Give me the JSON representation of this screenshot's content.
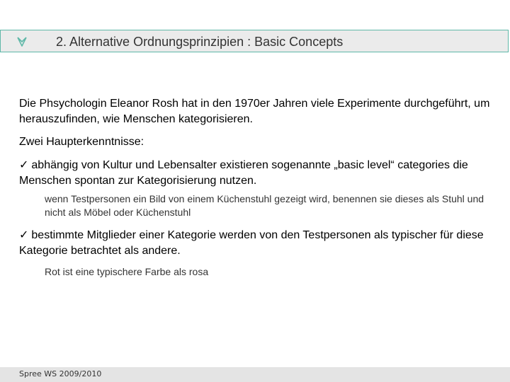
{
  "slide": {
    "title": "2. Alternative Ordnungsprinzipien : Basic Concepts",
    "title_icon": "teal-arrow-bullet-icon",
    "accent_color": "#5fb8a8",
    "intro": "Die Phsychologin Eleanor Rosh hat in den 1970er Jahren viele Experimente durchgeführt, um herauszufinden, wie Menschen kategorisieren.",
    "findings_heading": "Zwei Haupterkenntnisse:",
    "finding1": {
      "check": "✓",
      "text": "abhängig von Kultur und Lebensalter existieren sogenannte „basic level“ categories die Menschen spontan zur Kategorisierung nutzen.",
      "example": "wenn Testpersonen ein Bild von einem Küchenstuhl gezeigt wird, benennen sie dieses als Stuhl und nicht als Möbel oder Küchenstuhl"
    },
    "finding2": {
      "check": "✓",
      "text": "bestimmte Mitglieder einer Kategorie werden von den Testpersonen als typischer für diese Kategorie betrachtet als andere.",
      "example": "Rot ist eine typischere Farbe als rosa"
    },
    "footer": "Spree WS 2009/2010"
  }
}
